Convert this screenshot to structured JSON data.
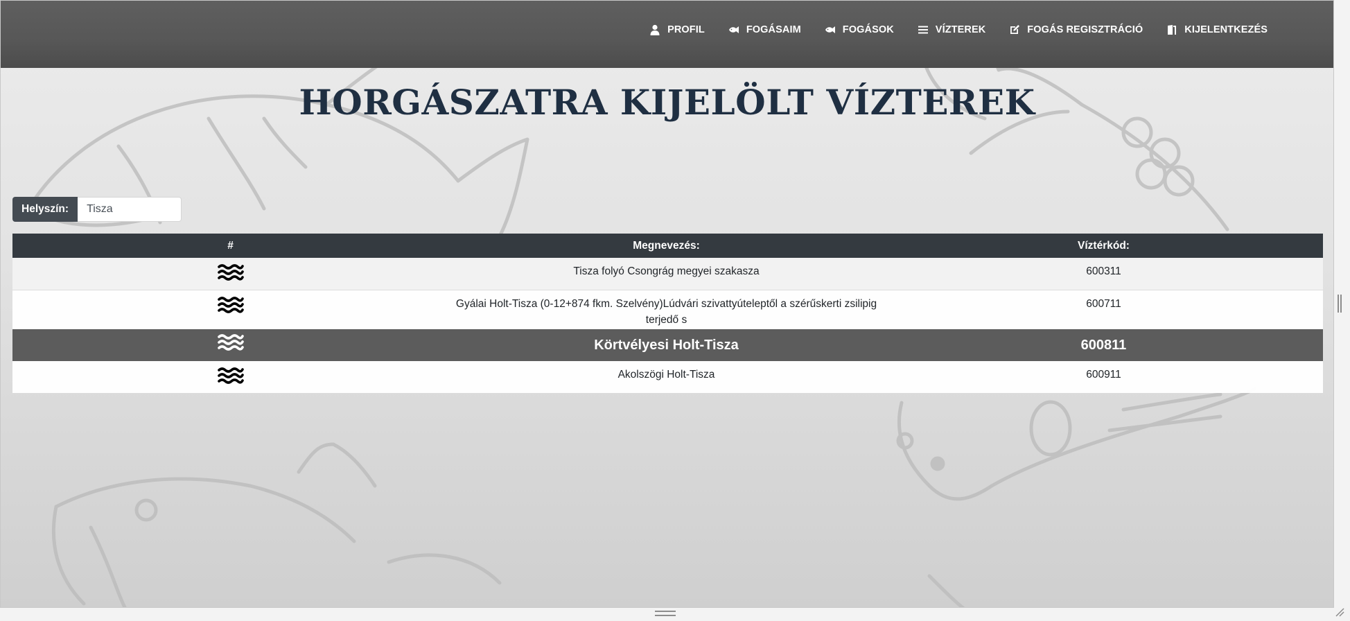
{
  "nav": {
    "items": [
      {
        "label": "PROFIL",
        "icon": "user-icon"
      },
      {
        "label": "FOGÁSAIM",
        "icon": "fish-icon"
      },
      {
        "label": "FOGÁSOK",
        "icon": "fish-icon"
      },
      {
        "label": "VÍZTEREK",
        "icon": "water-icon"
      },
      {
        "label": "FOGÁS REGISZTRÁCIÓ",
        "icon": "edit-icon"
      },
      {
        "label": "KIJELENTKEZÉS",
        "icon": "logout-icon"
      }
    ]
  },
  "page": {
    "title": "HORGÁSZATRA KIJELÖLT VÍZTEREK"
  },
  "filter": {
    "label": "Helyszín:",
    "value": "Tisza"
  },
  "table": {
    "headers": {
      "icon": "#",
      "name": "Megnevezés:",
      "code": "Víztérkód:"
    },
    "rows": [
      {
        "name": "Tisza folyó Csongrág megyei szakasza",
        "code": "600311",
        "icon": "water-waves-icon"
      },
      {
        "name": "Gyálai Holt-Tisza (0-12+874 fkm. Szelvény)Lúdvári szivattyúteleptől a szérűskerti zsilipig terjedő s",
        "code": "600711",
        "icon": "water-waves-icon"
      },
      {
        "name": "Körtvélyesi Holt-Tisza",
        "code": "600811",
        "icon": "water-waves-icon"
      },
      {
        "name": "Akolszögi Holt-Tisza",
        "code": "600911",
        "icon": "water-waves-icon"
      }
    ]
  },
  "colors": {
    "navbar": "#585858",
    "title": "#1f2f42",
    "table_header": "#343a40",
    "highlight_row": "#5c5c5c"
  }
}
